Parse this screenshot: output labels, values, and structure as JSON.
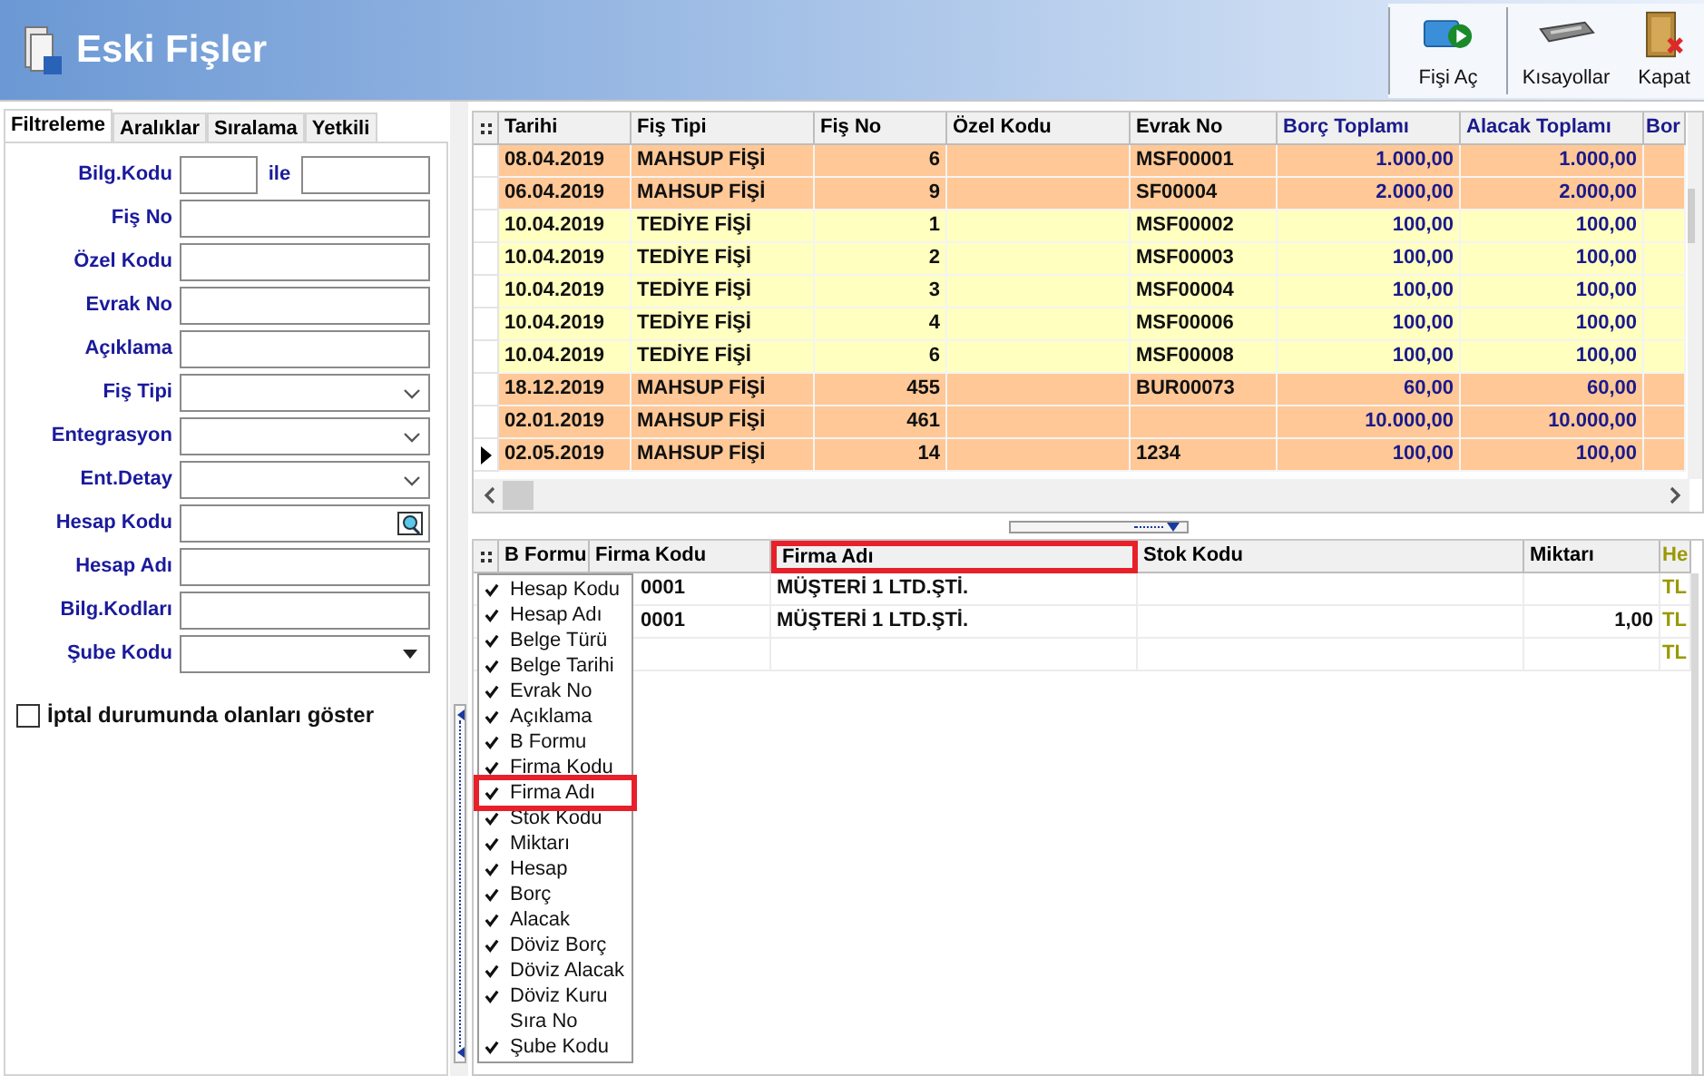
{
  "window": {
    "title": "Eski Fişler"
  },
  "toolbar": [
    {
      "label": "Fişi Aç",
      "kind": "open"
    },
    {
      "label": "Kısayollar",
      "kind": "keyboard"
    },
    {
      "label": "Kapat",
      "kind": "close"
    }
  ],
  "filter_tabs": [
    {
      "label": "Filtreleme",
      "selected": true
    },
    {
      "label": "Aralıklar",
      "selected": false
    },
    {
      "label": "Sıralama",
      "selected": false
    },
    {
      "label": "Yetkili",
      "selected": false
    }
  ],
  "filter_fields": [
    {
      "label": "Bilg.Kodu",
      "kind": "range",
      "joiner": "ile"
    },
    {
      "label": "Fiş No",
      "kind": "text"
    },
    {
      "label": "Özel Kodu",
      "kind": "text"
    },
    {
      "label": "Evrak No",
      "kind": "text"
    },
    {
      "label": "Açıklama",
      "kind": "text"
    },
    {
      "label": "Fiş Tipi",
      "kind": "combo"
    },
    {
      "label": "Entegrasyon",
      "kind": "combo"
    },
    {
      "label": "Ent.Detay",
      "kind": "combo"
    },
    {
      "label": "Hesap Kodu",
      "kind": "lookup"
    },
    {
      "label": "Hesap Adı",
      "kind": "text"
    },
    {
      "label": "Bilg.Kodları",
      "kind": "text"
    },
    {
      "label": "Şube Kodu",
      "kind": "dropdown"
    }
  ],
  "show_cancelled": {
    "label": "İptal durumunda olanları göster",
    "checked": false
  },
  "vouchers": {
    "columns": [
      {
        "label": "Tarihi",
        "color": "#000000"
      },
      {
        "label": "Fiş Tipi",
        "color": "#000000"
      },
      {
        "label": "Fiş No",
        "color": "#000000"
      },
      {
        "label": "Özel Kodu",
        "color": "#000000"
      },
      {
        "label": "Evrak No",
        "color": "#000000"
      },
      {
        "label": "Borç Toplamı",
        "color": "#1a1a8c"
      },
      {
        "label": "Alacak Toplamı",
        "color": "#1a1a8c"
      },
      {
        "label": "Bor",
        "color": "#1a1a8c"
      }
    ],
    "rows": [
      {
        "cells": [
          "08.04.2019",
          "MAHSUP FİŞİ",
          "6",
          null,
          "MSF00001",
          "1.000,00",
          "1.000,00",
          null
        ],
        "color": "#ffc896",
        "current": false
      },
      {
        "cells": [
          "06.04.2019",
          "MAHSUP FİŞİ",
          "9",
          null,
          "SF00004",
          "2.000,00",
          "2.000,00",
          null
        ],
        "color": "#ffc896",
        "current": false
      },
      {
        "cells": [
          "10.04.2019",
          "TEDİYE FİŞİ",
          "1",
          null,
          "MSF00002",
          "100,00",
          "100,00",
          null
        ],
        "color": "#ffffc0",
        "current": false
      },
      {
        "cells": [
          "10.04.2019",
          "TEDİYE FİŞİ",
          "2",
          null,
          "MSF00003",
          "100,00",
          "100,00",
          null
        ],
        "color": "#ffffc0",
        "current": false
      },
      {
        "cells": [
          "10.04.2019",
          "TEDİYE FİŞİ",
          "3",
          null,
          "MSF00004",
          "100,00",
          "100,00",
          null
        ],
        "color": "#ffffc0",
        "current": false
      },
      {
        "cells": [
          "10.04.2019",
          "TEDİYE FİŞİ",
          "4",
          null,
          "MSF00006",
          "100,00",
          "100,00",
          null
        ],
        "color": "#ffffc0",
        "current": false
      },
      {
        "cells": [
          "10.04.2019",
          "TEDİYE FİŞİ",
          "6",
          null,
          "MSF00008",
          "100,00",
          "100,00",
          null
        ],
        "color": "#ffffc0",
        "current": false
      },
      {
        "cells": [
          "18.12.2019",
          "MAHSUP FİŞİ",
          "455",
          null,
          "BUR00073",
          "60,00",
          "60,00",
          null
        ],
        "color": "#ffc896",
        "current": false
      },
      {
        "cells": [
          "02.01.2019",
          "MAHSUP FİŞİ",
          "461",
          null,
          null,
          "10.000,00",
          "10.000,00",
          null
        ],
        "color": "#ffc896",
        "current": false
      },
      {
        "cells": [
          "02.05.2019",
          "MAHSUP FİŞİ",
          "14",
          null,
          "1234",
          "100,00",
          "100,00",
          null
        ],
        "color": "#ffc896",
        "current": true
      }
    ]
  },
  "lines": {
    "columns": [
      {
        "label": "B Formu",
        "color": "#000000",
        "highlighted": false
      },
      {
        "label": "Firma Kodu",
        "color": "#000000",
        "highlighted": false
      },
      {
        "label": "Firma Adı",
        "color": "#000000",
        "highlighted": true
      },
      {
        "label": "Stok Kodu",
        "color": "#000000",
        "highlighted": false
      },
      {
        "label": "Miktarı",
        "color": "#000000",
        "highlighted": false
      },
      {
        "label": "He",
        "color": "#999900",
        "highlighted": false
      }
    ],
    "rows": [
      {
        "cells": [
          null,
          "0001",
          "MÜŞTERİ 1 LTD.ŞTİ.",
          null,
          null,
          "TL"
        ]
      },
      {
        "cells": [
          null,
          "0001",
          "MÜŞTERİ 1 LTD.ŞTİ.",
          null,
          "1,00",
          "TL"
        ]
      },
      {
        "cells": [
          null,
          null,
          null,
          null,
          null,
          "TL"
        ]
      }
    ]
  },
  "column_menu": [
    {
      "label": "Hesap Kodu",
      "checked": true,
      "highlighted": false
    },
    {
      "label": "Hesap Adı",
      "checked": true,
      "highlighted": false
    },
    {
      "label": "Belge Türü",
      "checked": true,
      "highlighted": false
    },
    {
      "label": "Belge Tarihi",
      "checked": true,
      "highlighted": false
    },
    {
      "label": "Evrak No",
      "checked": true,
      "highlighted": false
    },
    {
      "label": "Açıklama",
      "checked": true,
      "highlighted": false
    },
    {
      "label": "B Formu",
      "checked": true,
      "highlighted": false
    },
    {
      "label": "Firma Kodu",
      "checked": true,
      "highlighted": false
    },
    {
      "label": "Firma Adı",
      "checked": true,
      "highlighted": true
    },
    {
      "label": "Stok Kodu",
      "checked": true,
      "highlighted": false
    },
    {
      "label": "Miktarı",
      "checked": true,
      "highlighted": false
    },
    {
      "label": "Hesap",
      "checked": true,
      "highlighted": false
    },
    {
      "label": "Borç",
      "checked": true,
      "highlighted": false
    },
    {
      "label": "Alacak",
      "checked": true,
      "highlighted": false
    },
    {
      "label": "Döviz Borç",
      "checked": true,
      "highlighted": false
    },
    {
      "label": "Döviz Alacak",
      "checked": true,
      "highlighted": false
    },
    {
      "label": "Döviz Kuru",
      "checked": true,
      "highlighted": false
    },
    {
      "label": "Sıra No",
      "checked": false,
      "highlighted": false
    },
    {
      "label": "Şube Kodu",
      "checked": true,
      "highlighted": false
    }
  ]
}
